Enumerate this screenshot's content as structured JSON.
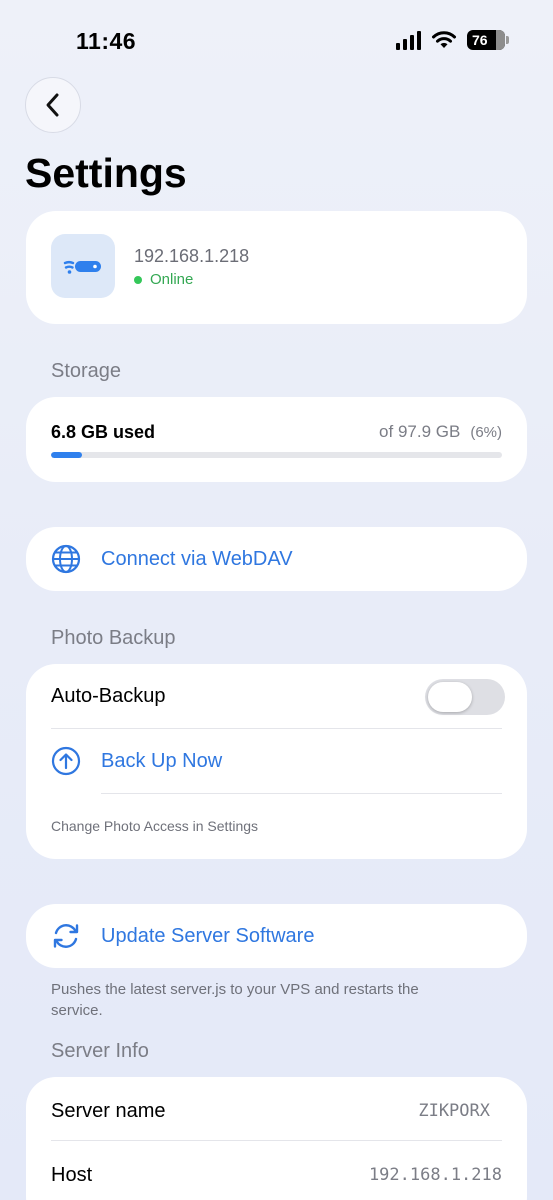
{
  "status_bar": {
    "time": "11:46",
    "battery": "76",
    "battery_fraction": 0.76
  },
  "header": {
    "back_icon": "chevron-left-icon",
    "title": "Settings"
  },
  "device": {
    "icon": "router-wifi-icon",
    "ip": "192.168.1.218",
    "status": "Online",
    "status_color": "#34c759"
  },
  "storage": {
    "section_title": "Storage",
    "used_label": "6.8 GB used",
    "total_label": "of 97.9 GB",
    "percent_label": "(6%)",
    "used_fraction": 0.069,
    "accent_color": "#2f80ed"
  },
  "webdav": {
    "icon": "globe-icon",
    "label": "Connect via WebDAV"
  },
  "photo_backup": {
    "section_title": "Photo Backup",
    "auto_backup_label": "Auto-Backup",
    "auto_backup_enabled": false,
    "backup_now_icon": "arrow-up-circle-icon",
    "backup_now_label": "Back Up Now",
    "footnote": "Change Photo Access in Settings"
  },
  "update": {
    "icon": "refresh-icon",
    "label": "Update Server Software",
    "note": "Pushes the latest server.js to your VPS and restarts the service."
  },
  "server_info": {
    "section_title": "Server Info",
    "rows": [
      {
        "key": "Server name",
        "value": "ZIKPORX"
      },
      {
        "key": "Host",
        "value": "192.168.1.218"
      }
    ]
  }
}
